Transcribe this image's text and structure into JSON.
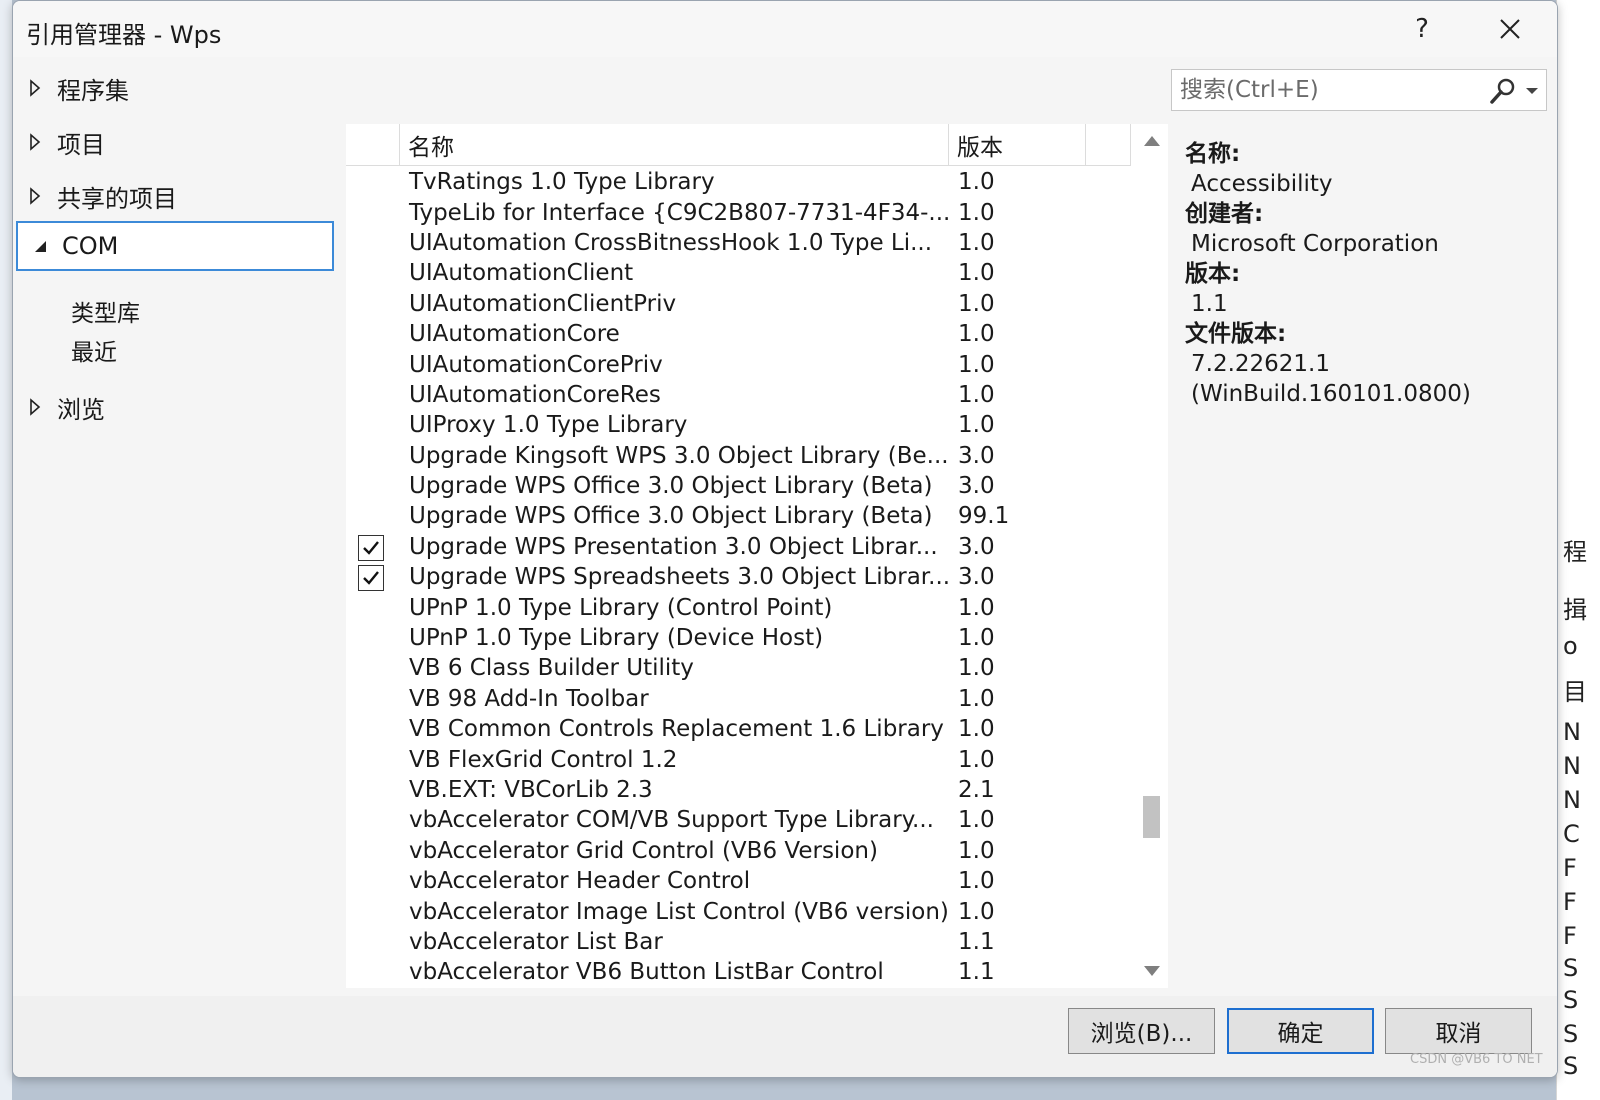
{
  "window": {
    "title": "引用管理器 - Wps",
    "help_label": "?",
    "close_label": "✕"
  },
  "nav": {
    "items": [
      {
        "label": "程序集",
        "expanded": false
      },
      {
        "label": "项目",
        "expanded": false
      },
      {
        "label": "共享的项目",
        "expanded": false
      },
      {
        "label": "COM",
        "expanded": true,
        "selected": true
      },
      {
        "label": "浏览",
        "expanded": false
      }
    ],
    "com_children": [
      "类型库",
      "最近"
    ]
  },
  "search": {
    "placeholder": "搜索(Ctrl+E)",
    "icon": "search-icon"
  },
  "list": {
    "columns": [
      "名称",
      "版本"
    ],
    "rows": [
      {
        "checked": false,
        "name": "TvRatings 1.0 Type Library",
        "version": "1.0"
      },
      {
        "checked": false,
        "name": "TypeLib for Interface {C9C2B807-7731-4F34-...",
        "version": "1.0"
      },
      {
        "checked": false,
        "name": "UIAutomation CrossBitnessHook 1.0 Type Li...",
        "version": "1.0"
      },
      {
        "checked": false,
        "name": "UIAutomationClient",
        "version": "1.0"
      },
      {
        "checked": false,
        "name": "UIAutomationClientPriv",
        "version": "1.0"
      },
      {
        "checked": false,
        "name": "UIAutomationCore",
        "version": "1.0"
      },
      {
        "checked": false,
        "name": "UIAutomationCorePriv",
        "version": "1.0"
      },
      {
        "checked": false,
        "name": "UIAutomationCoreRes",
        "version": "1.0"
      },
      {
        "checked": false,
        "name": "UIProxy 1.0 Type Library",
        "version": "1.0"
      },
      {
        "checked": false,
        "name": "Upgrade Kingsoft WPS 3.0 Object Library (Be...",
        "version": "3.0"
      },
      {
        "checked": false,
        "name": "Upgrade WPS Office 3.0 Object Library (Beta)",
        "version": "3.0"
      },
      {
        "checked": false,
        "name": "Upgrade WPS Office 3.0 Object Library (Beta)",
        "version": "99.1"
      },
      {
        "checked": true,
        "name": "Upgrade WPS Presentation 3.0 Object Librar...",
        "version": "3.0"
      },
      {
        "checked": true,
        "name": "Upgrade WPS Spreadsheets 3.0 Object Librar...",
        "version": "3.0"
      },
      {
        "checked": false,
        "name": "UPnP 1.0 Type Library (Control Point)",
        "version": "1.0"
      },
      {
        "checked": false,
        "name": "UPnP 1.0 Type Library (Device Host)",
        "version": "1.0"
      },
      {
        "checked": false,
        "name": "VB 6 Class Builder Utility",
        "version": "1.0"
      },
      {
        "checked": false,
        "name": "VB 98 Add-In Toolbar",
        "version": "1.0"
      },
      {
        "checked": false,
        "name": "VB Common Controls Replacement 1.6 Library",
        "version": "1.0"
      },
      {
        "checked": false,
        "name": "VB FlexGrid Control 1.2",
        "version": "1.0"
      },
      {
        "checked": false,
        "name": "VB.EXT: VBCorLib 2.3",
        "version": "2.1"
      },
      {
        "checked": false,
        "name": "vbAccelerator COM/VB Support Type Library...",
        "version": "1.0"
      },
      {
        "checked": false,
        "name": "vbAccelerator Grid Control (VB6 Version)",
        "version": "1.0"
      },
      {
        "checked": false,
        "name": "vbAccelerator Header Control",
        "version": "1.0"
      },
      {
        "checked": false,
        "name": "vbAccelerator Image List Control (VB6 version)",
        "version": "1.0"
      },
      {
        "checked": false,
        "name": "vbAccelerator List Bar",
        "version": "1.1"
      },
      {
        "checked": false,
        "name": "vbAccelerator VB6 Button ListBar Control",
        "version": "1.1"
      }
    ]
  },
  "details": {
    "name_label": "名称:",
    "name_value": "Accessibility",
    "creator_label": "创建者:",
    "creator_value": "Microsoft Corporation",
    "version_label": "版本:",
    "version_value": "1.1",
    "file_version_label": "文件版本:",
    "file_version_value_1": "7.2.22621.1",
    "file_version_value_2": "(WinBuild.160101.0800)"
  },
  "buttons": {
    "browse": "浏览(B)...",
    "ok": "确定",
    "cancel": "取消"
  },
  "background_right": [
    "程",
    "揖",
    "o",
    "目",
    "N",
    "N",
    "N",
    "C",
    "F",
    "F",
    "F",
    "S",
    "S",
    "S",
    "S"
  ],
  "watermark": "CSDN @VB6 TO NET",
  "colors": {
    "accent": "#3c8ad8",
    "ok_border": "#1e6fd0"
  }
}
